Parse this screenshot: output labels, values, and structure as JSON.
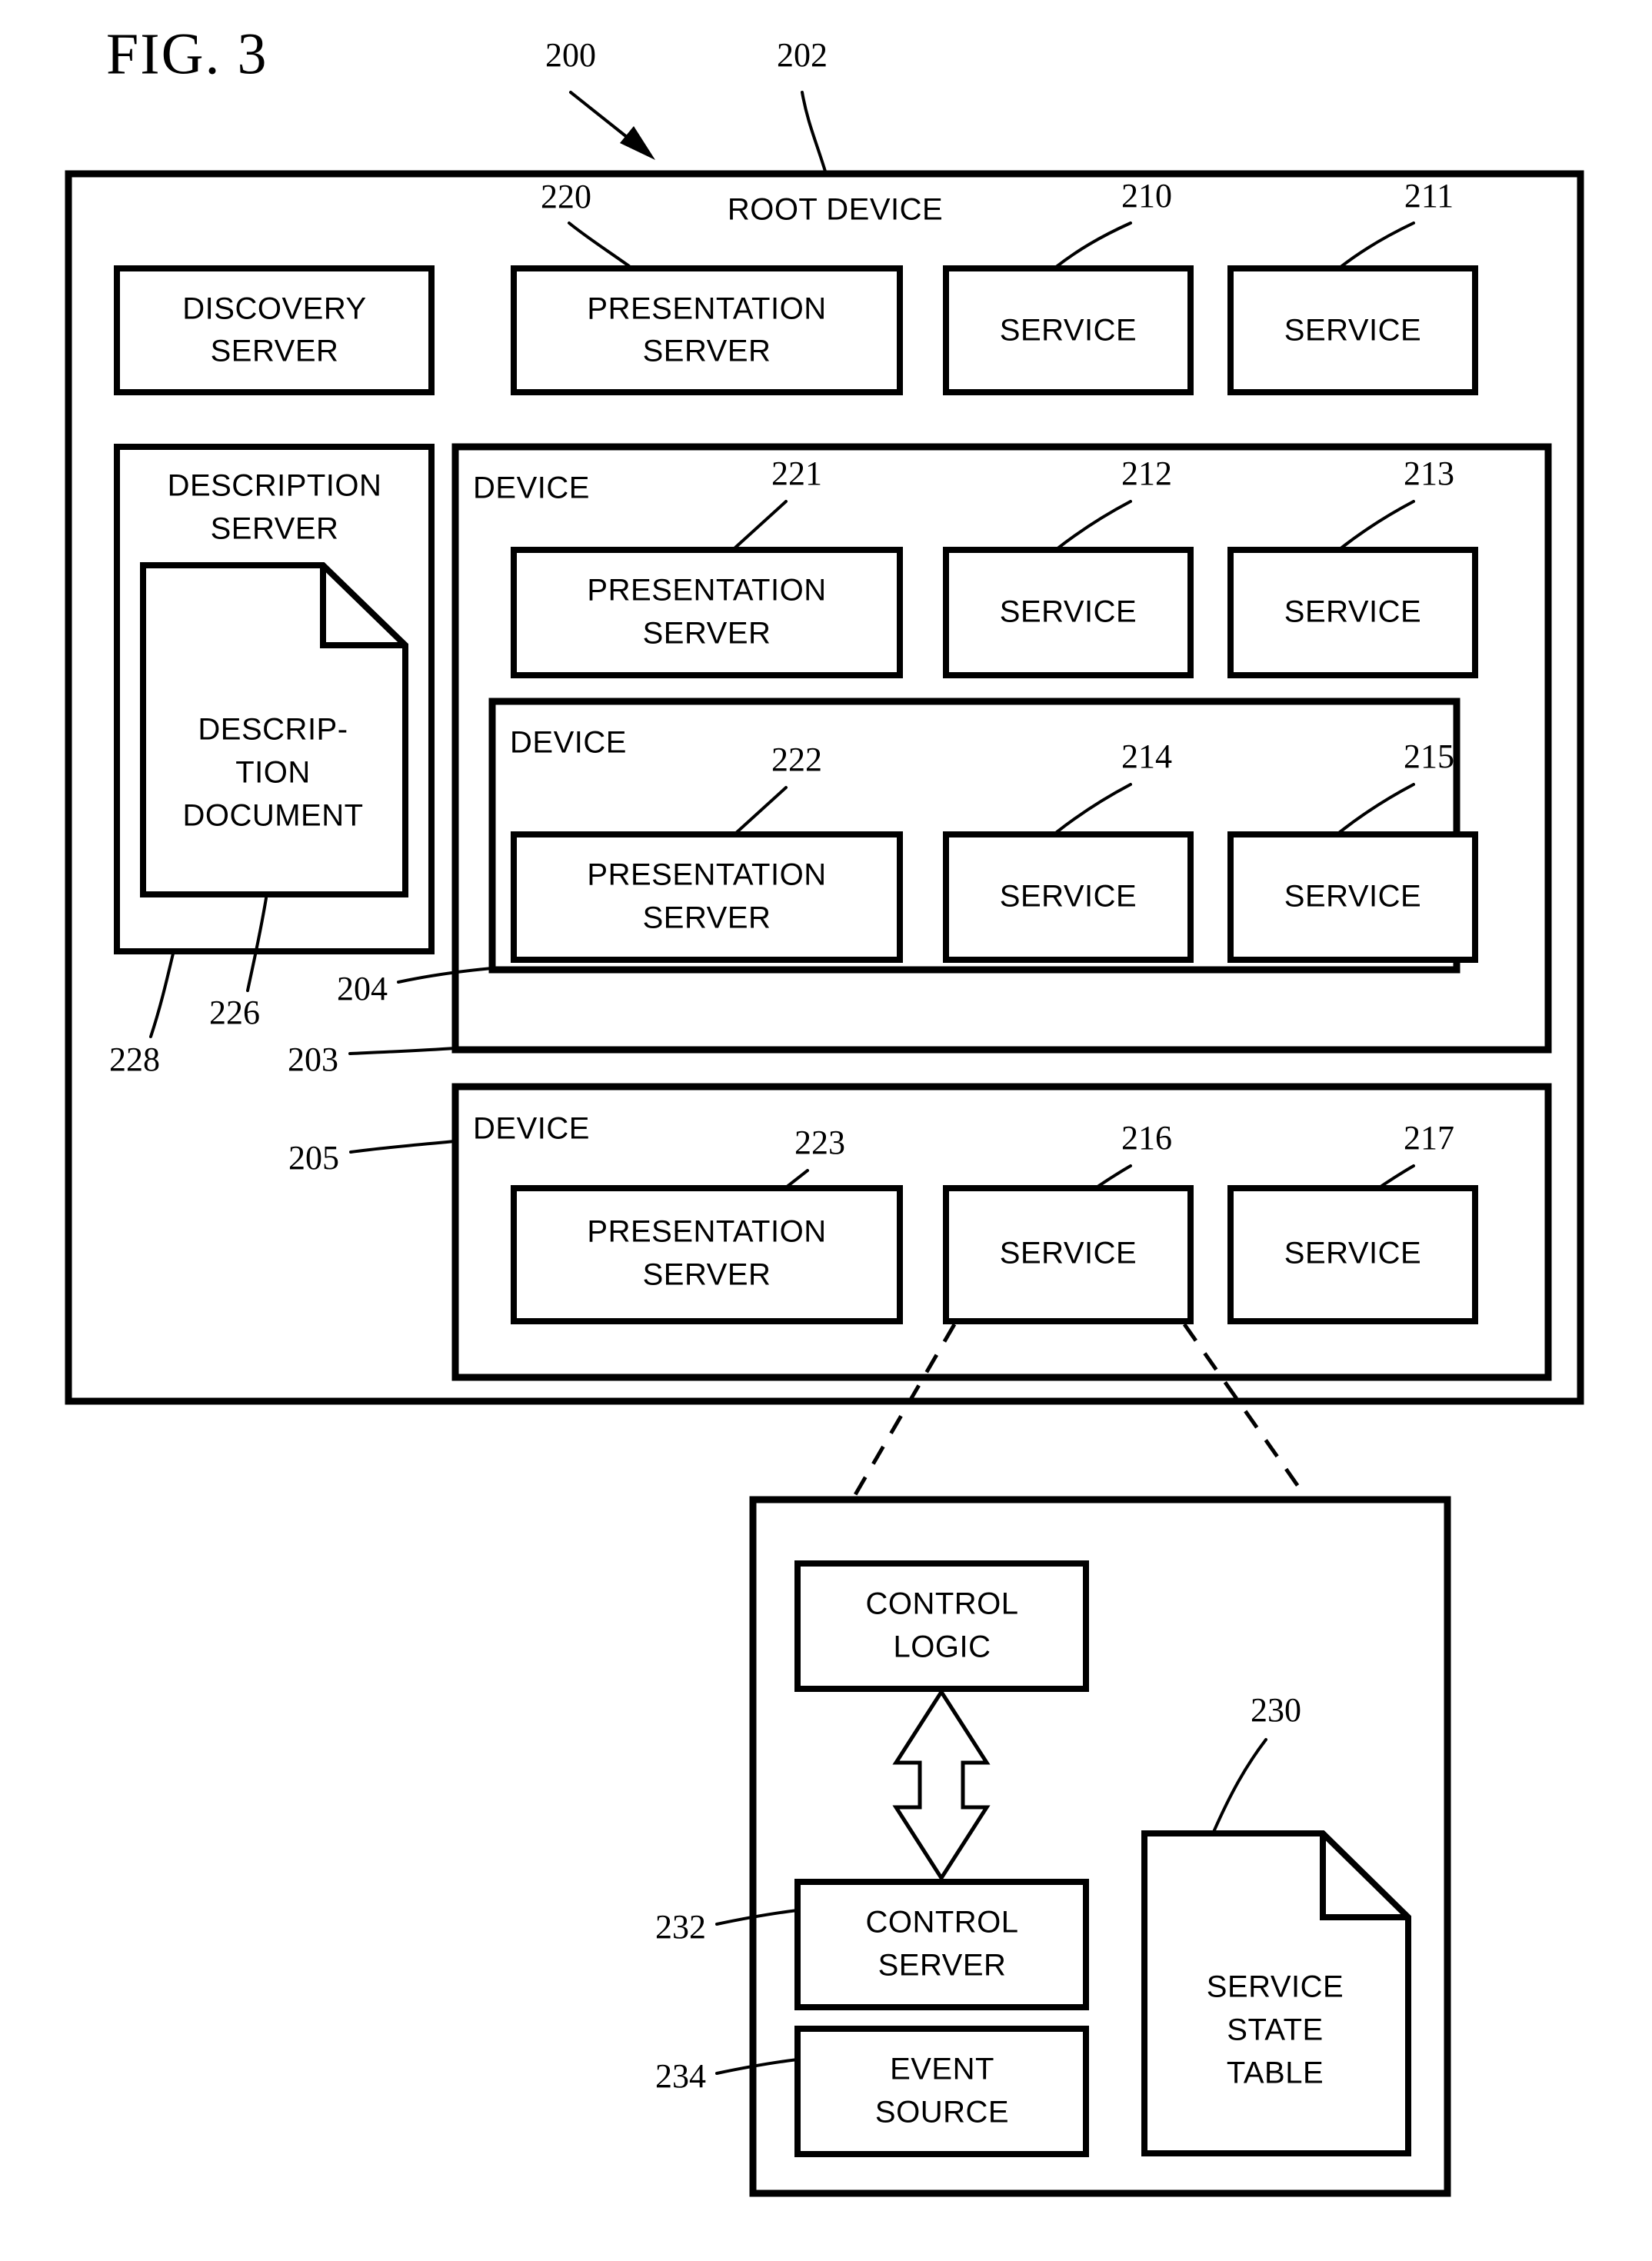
{
  "figure": {
    "title": "FIG. 3"
  },
  "root_device": {
    "label": "ROOT DEVICE",
    "ref": "202",
    "system_ref": "200",
    "top_row": [
      {
        "label_line1": "DISCOVERY",
        "label_line2": "SERVER",
        "name": "discovery-server"
      },
      {
        "label_line1": "PRESENTATION",
        "label_line2": "SERVER",
        "name": "presentation-server-220",
        "ref": "220"
      },
      {
        "label_line1": "SERVICE",
        "label_line2": "",
        "name": "service-210",
        "ref": "210"
      },
      {
        "label_line1": "SERVICE",
        "label_line2": "",
        "name": "service-211",
        "ref": "211"
      }
    ],
    "description_server": {
      "label_line1": "DESCRIPTION",
      "label_line2": "SERVER",
      "ref": "228",
      "document": {
        "label_line1": "DESCRIP-",
        "label_line2": "TION",
        "label_line3": "DOCUMENT",
        "ref": "226"
      }
    },
    "device_203": {
      "label": "DEVICE",
      "ref": "203",
      "items": [
        {
          "label_line1": "PRESENTATION",
          "label_line2": "SERVER",
          "name": "presentation-server-221",
          "ref": "221"
        },
        {
          "label_line1": "SERVICE",
          "label_line2": "",
          "name": "service-212",
          "ref": "212"
        },
        {
          "label_line1": "SERVICE",
          "label_line2": "",
          "name": "service-213",
          "ref": "213"
        }
      ]
    },
    "device_204": {
      "label": "DEVICE",
      "ref": "204",
      "items": [
        {
          "label_line1": "PRESENTATION",
          "label_line2": "SERVER",
          "name": "presentation-server-222",
          "ref": "222"
        },
        {
          "label_line1": "SERVICE",
          "label_line2": "",
          "name": "service-214",
          "ref": "214"
        },
        {
          "label_line1": "SERVICE",
          "label_line2": "",
          "name": "service-215",
          "ref": "215"
        }
      ]
    },
    "device_205": {
      "label": "DEVICE",
      "ref": "205",
      "items": [
        {
          "label_line1": "PRESENTATION",
          "label_line2": "SERVER",
          "name": "presentation-server-223",
          "ref": "223"
        },
        {
          "label_line1": "SERVICE",
          "label_line2": "",
          "name": "service-216",
          "ref": "216"
        },
        {
          "label_line1": "SERVICE",
          "label_line2": "",
          "name": "service-217",
          "ref": "217"
        }
      ]
    }
  },
  "service_detail": {
    "control_logic": {
      "label_line1": "CONTROL",
      "label_line2": "LOGIC"
    },
    "control_server": {
      "label_line1": "CONTROL",
      "label_line2": "SERVER",
      "ref": "232"
    },
    "event_source": {
      "label_line1": "EVENT",
      "label_line2": "SOURCE",
      "ref": "234"
    },
    "service_state_table": {
      "label_line1": "SERVICE",
      "label_line2": "STATE",
      "label_line3": "TABLE",
      "ref": "230"
    }
  },
  "colors": {
    "ink": "#000000",
    "paper": "#ffffff"
  }
}
